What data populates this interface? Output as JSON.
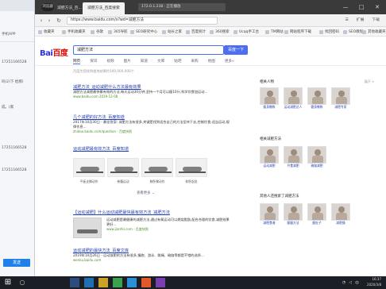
{
  "left_app": {
    "rows": [
      "手机APP",
      "17251166528",
      "吗(2)下 给那(",
      "成。(家",
      "17251166528",
      "17251166528"
    ],
    "button_label": "发送"
  },
  "browser": {
    "logo_text": "浏览器",
    "tabs": [
      {
        "label": "减肥方法_百...",
        "active": false
      },
      {
        "label": "减肥方法_百度搜索",
        "active": true
      }
    ],
    "address_overlay": "172.0.1.238 · 正在播放",
    "window_controls": [
      "—",
      "□",
      "✕"
    ],
    "url": "https://www.baidu.com/s?wd=减肥方法",
    "toolbar_right": [
      "☰",
      "扩展",
      "下载"
    ],
    "bookmarks": [
      "收藏夹",
      "手机收藏夹",
      "谷歌",
      "365导航",
      "SEO研究中心",
      "站长之家",
      "百度统计",
      "360搜索",
      "Ucqq手工台",
      "TM网站",
      "网站程序下载",
      "找回密码",
      "SEO教程",
      "其他收藏夹"
    ]
  },
  "page": {
    "logo_left": "Bai",
    "logo_right": "百度",
    "search_query": "减肥方法",
    "search_button": "百度一下",
    "search_tabs": [
      {
        "label": "网页",
        "on": true
      },
      {
        "label": "资讯",
        "on": false
      },
      {
        "label": "视频",
        "on": false
      },
      {
        "label": "图片",
        "on": false
      },
      {
        "label": "知道",
        "on": false
      },
      {
        "label": "文库",
        "on": false
      },
      {
        "label": "贴吧",
        "on": false
      },
      {
        "label": "采购",
        "on": false
      },
      {
        "label": "地图",
        "on": false
      },
      {
        "label": "更多»",
        "on": false
      }
    ],
    "result_count": "百度为您找到相关结果约100,000,000个",
    "results": [
      {
        "title": "减肥方法_运动减肥什么方法最有效果",
        "desc": "减肥方法减肥最快最有效的方法,每天运动30分钟,坚持一个月可以瘦10斤,科学饮食加运动...",
        "url": "www.baidu.com  2019-12-08"
      },
      {
        "title": "几个减肥的好方法_百度知道",
        "desc": "2017年10月30日 - 最佳答案: 减肥方法有很多,关键是找到适合自己的方法坚持下去,控制饮食,适当运动,规律作息...",
        "url": "zhidao.baidu.com/question - 百度快照"
      },
      {
        "title": "运动减肥最有效方法_百度知道",
        "desc": "",
        "url": ""
      },
      {
        "title": "【运动减肥】什么运动减肥最快最有效方法_减肥方法",
        "desc": "运动减肥是最健康的减肥方法,通过有氧运动可以燃烧脂肪,配合合理的饮食,减肥效果更好...",
        "url": "www.jianfei.com - 百度快照"
      },
      {
        "title": "运动减肥的最快方法_百度文库",
        "desc": "2019年10月26日 - 运动减肥的方法有很多,慢跑、游泳、跳绳、瑜伽等都是不错的选择...",
        "url": "wenku.baidu.com"
      }
    ],
    "exercise_captions": [
      "平板支撑动作",
      "卷腹运动",
      "俯卧撑动作",
      "仰卧起坐"
    ],
    "more_link": "查看更多 ⌄",
    "right": {
      "section1_title": "相关人物",
      "section1_more": "展开 ∨",
      "people1": [
        "瘦身教练",
        "运动减肥达人",
        "健身教练",
        "减肥专家"
      ],
      "section2_title": "相关减肥方法",
      "people2": [
        "运动减肥",
        "节食减肥",
        "瑜伽减肥"
      ],
      "section3_title": "其他人还搜索了减肥方法",
      "people3": [
        "减肥食谱",
        "瘦腿方法",
        "瘦肚子",
        "减肥操"
      ]
    }
  },
  "taskbar": {
    "start_icon": "windows-icon",
    "time": "16:37",
    "date": "2020/3/8",
    "lang": "中"
  }
}
